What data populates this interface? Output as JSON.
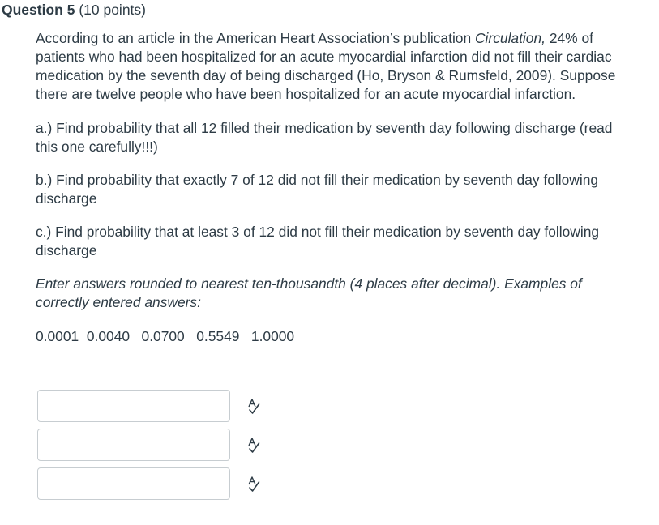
{
  "question": {
    "name": "Question 5",
    "points": "(10 points)"
  },
  "body": {
    "intro_before": "According to an article in the American Heart Association’s publication ",
    "intro_journal": "Circulation,",
    "intro_after": " 24% of patients who had been hospitalized for an acute myocardial infarction did not fill their cardiac medication by the seventh day of being discharged (Ho, Bryson & Rumsfeld, 2009).  Suppose there are twelve people who have been hospitalized for an acute myocardial infarction.",
    "part_a": "a.) Find probability that all 12 filled their medication by seventh day following discharge (read this one carefully!!!)",
    "part_b": "b.) Find probability that exactly 7 of 12 did not fill their medication by seventh day following discharge",
    "part_c": "c.) Find probability that at least 3 of 12 did not fill their medication by seventh day following discharge",
    "instructions": "Enter answers rounded to nearest ten-thousandth (4 places after decimal).  Examples of correctly entered answers:",
    "examples": "0.0001  0.0040   0.0700   0.5549   1.0000"
  },
  "answers": [
    {
      "value": "",
      "icon": "spell-check-icon"
    },
    {
      "value": "",
      "icon": "spell-check-icon"
    },
    {
      "value": "",
      "icon": "spell-check-icon"
    }
  ],
  "colors": {
    "text": "#2d3b45",
    "input_border": "#c7cdd1",
    "icon": "#2d3b45"
  }
}
